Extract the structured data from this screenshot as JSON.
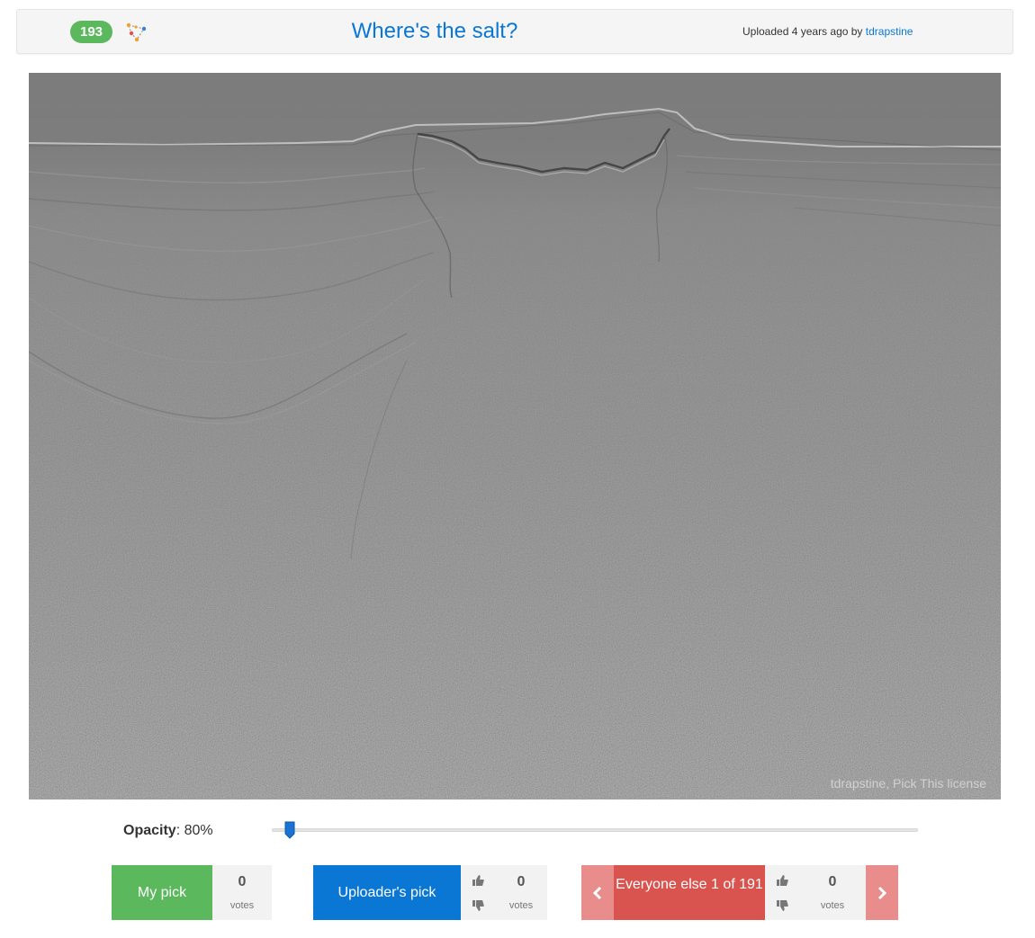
{
  "header": {
    "count": "193",
    "title": "Where's the salt?",
    "uploaded_prefix": "Uploaded 4 years ago by",
    "uploader": "tdrapstine"
  },
  "viewer": {
    "license": "tdrapstine, Pick This license"
  },
  "opacity": {
    "label": "Opacity",
    "value": "80%",
    "level": 0.8
  },
  "my_pick": {
    "label": "My pick",
    "votes": "0",
    "votes_label": "votes"
  },
  "uploader_pick": {
    "label": "Uploader's pick",
    "votes": "0",
    "votes_label": "votes"
  },
  "everyone_else": {
    "label": "Everyone else 1 of 191",
    "votes": "0",
    "votes_label": "votes"
  },
  "colors": {
    "accent": "#0a77d5",
    "success": "#5cb85c",
    "danger": "#d9534f",
    "danger_light": "#e98c8c"
  },
  "icons": [
    "pick-polygon-icon",
    "thumbs-up-icon",
    "thumbs-down-icon",
    "chevron-left-icon",
    "chevron-right-icon"
  ]
}
